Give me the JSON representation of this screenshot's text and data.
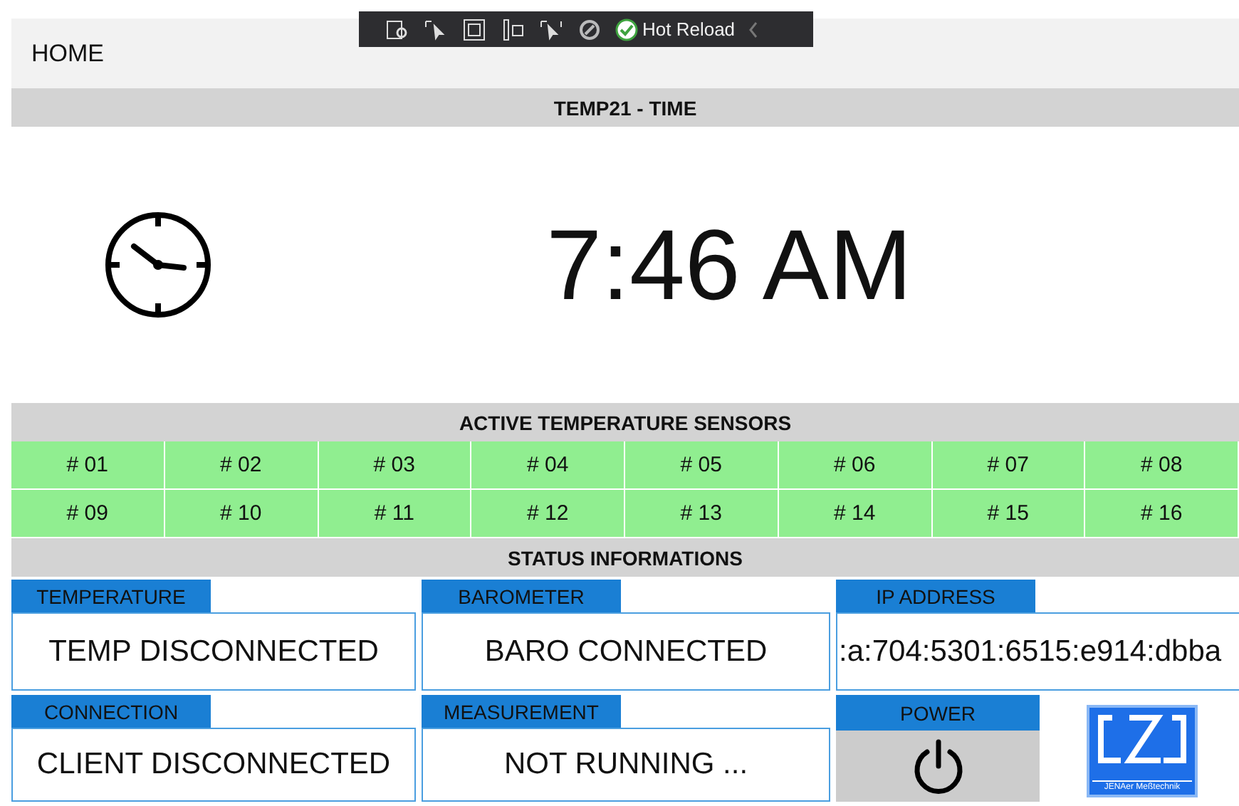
{
  "toolbar": {
    "label": "Hot Reload"
  },
  "app_bar": {
    "title": "HOME"
  },
  "time_section": {
    "header": "TEMP21 - TIME",
    "time": "7:46 AM"
  },
  "sensors": {
    "header": "ACTIVE TEMPERATURE SENSORS",
    "items": [
      {
        "label": "# 01",
        "active": true
      },
      {
        "label": "# 02",
        "active": true
      },
      {
        "label": "# 03",
        "active": true
      },
      {
        "label": "# 04",
        "active": true
      },
      {
        "label": "# 05",
        "active": true
      },
      {
        "label": "# 06",
        "active": true
      },
      {
        "label": "# 07",
        "active": true
      },
      {
        "label": "# 08",
        "active": true
      },
      {
        "label": "# 09",
        "active": true
      },
      {
        "label": "# 10",
        "active": true
      },
      {
        "label": "# 11",
        "active": true
      },
      {
        "label": "# 12",
        "active": true
      },
      {
        "label": "# 13",
        "active": true
      },
      {
        "label": "# 14",
        "active": true
      },
      {
        "label": "# 15",
        "active": true
      },
      {
        "label": "# 16",
        "active": true
      }
    ]
  },
  "status": {
    "header": "STATUS INFORMATIONS",
    "tiles": [
      {
        "kind": "value",
        "label": "TEMPERATURE",
        "value": "TEMP DISCONNECTED"
      },
      {
        "kind": "value",
        "label": "BAROMETER",
        "value": "BARO CONNECTED"
      },
      {
        "kind": "value",
        "label": "IP ADDRESS",
        "value": ":a:704:5301:6515:e914:dbba"
      },
      {
        "kind": "value",
        "label": "CONNECTION",
        "value": "CLIENT DISCONNECTED"
      },
      {
        "kind": "value",
        "label": "MEASUREMENT",
        "value": "NOT RUNNING ..."
      },
      {
        "kind": "button",
        "label": "POWER"
      },
      {
        "kind": "logo",
        "caption": "JENAer Meßtechnik"
      }
    ]
  }
}
